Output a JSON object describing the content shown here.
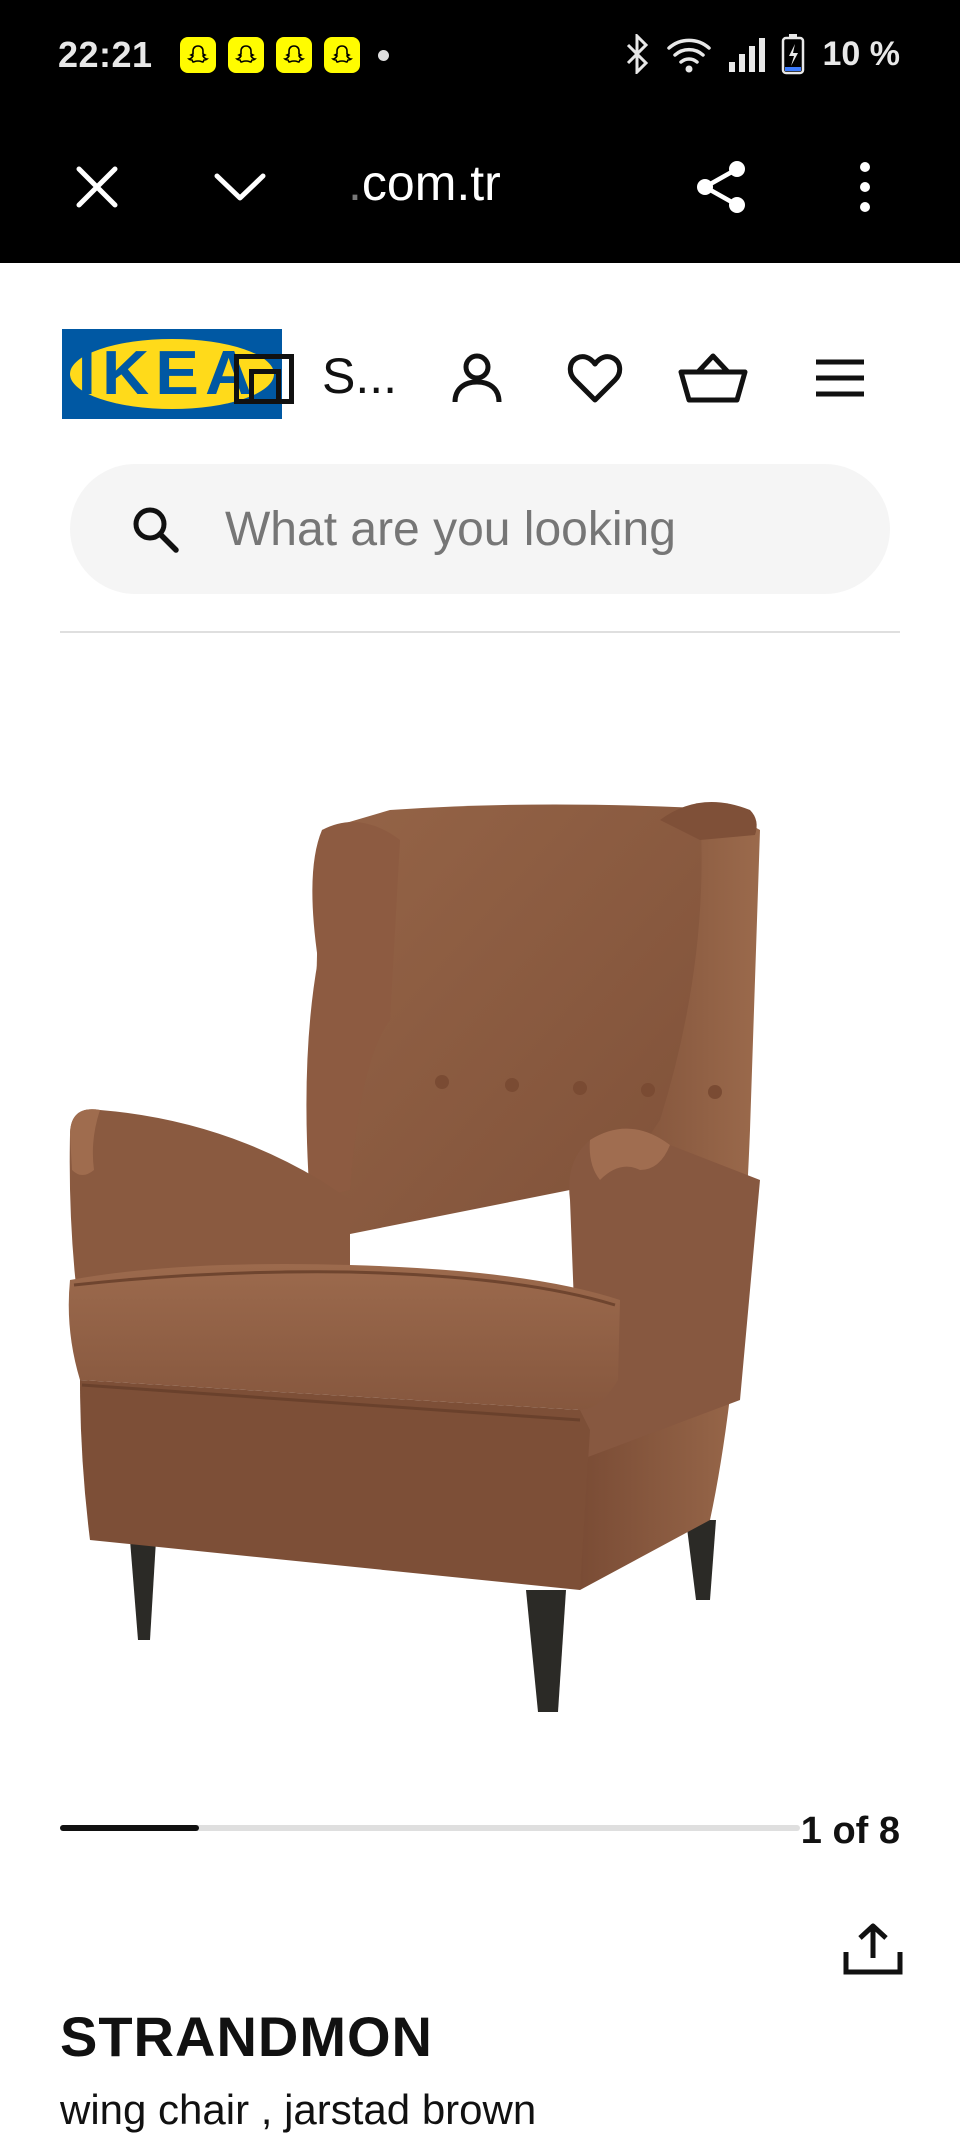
{
  "status_bar": {
    "time": "22:21",
    "notification_icons": [
      "snapchat-icon",
      "snapchat-icon",
      "snapchat-icon",
      "snapchat-icon"
    ],
    "battery": "10 %",
    "icons": [
      "bluetooth-icon",
      "wifi-icon",
      "signal-icon",
      "battery-charging-icon"
    ]
  },
  "browser": {
    "url_prefix": ".",
    "url": "com.tr"
  },
  "header": {
    "logo_text": "IKEA",
    "truncated_label": "S...",
    "icons": [
      "user-icon",
      "heart-icon",
      "cart-icon",
      "menu-icon"
    ]
  },
  "search": {
    "placeholder": "What are you looking"
  },
  "carousel": {
    "counter": "1 of 8",
    "progress_fraction": 0.125
  },
  "product": {
    "name": "STRANDMON",
    "description": "wing chair , jarstad brown"
  },
  "colors": {
    "ikea_blue": "#0058a3",
    "ikea_yellow": "#ffda1a",
    "snapchat_yellow": "#fffc00",
    "chair_brown": "#8a5a40"
  }
}
